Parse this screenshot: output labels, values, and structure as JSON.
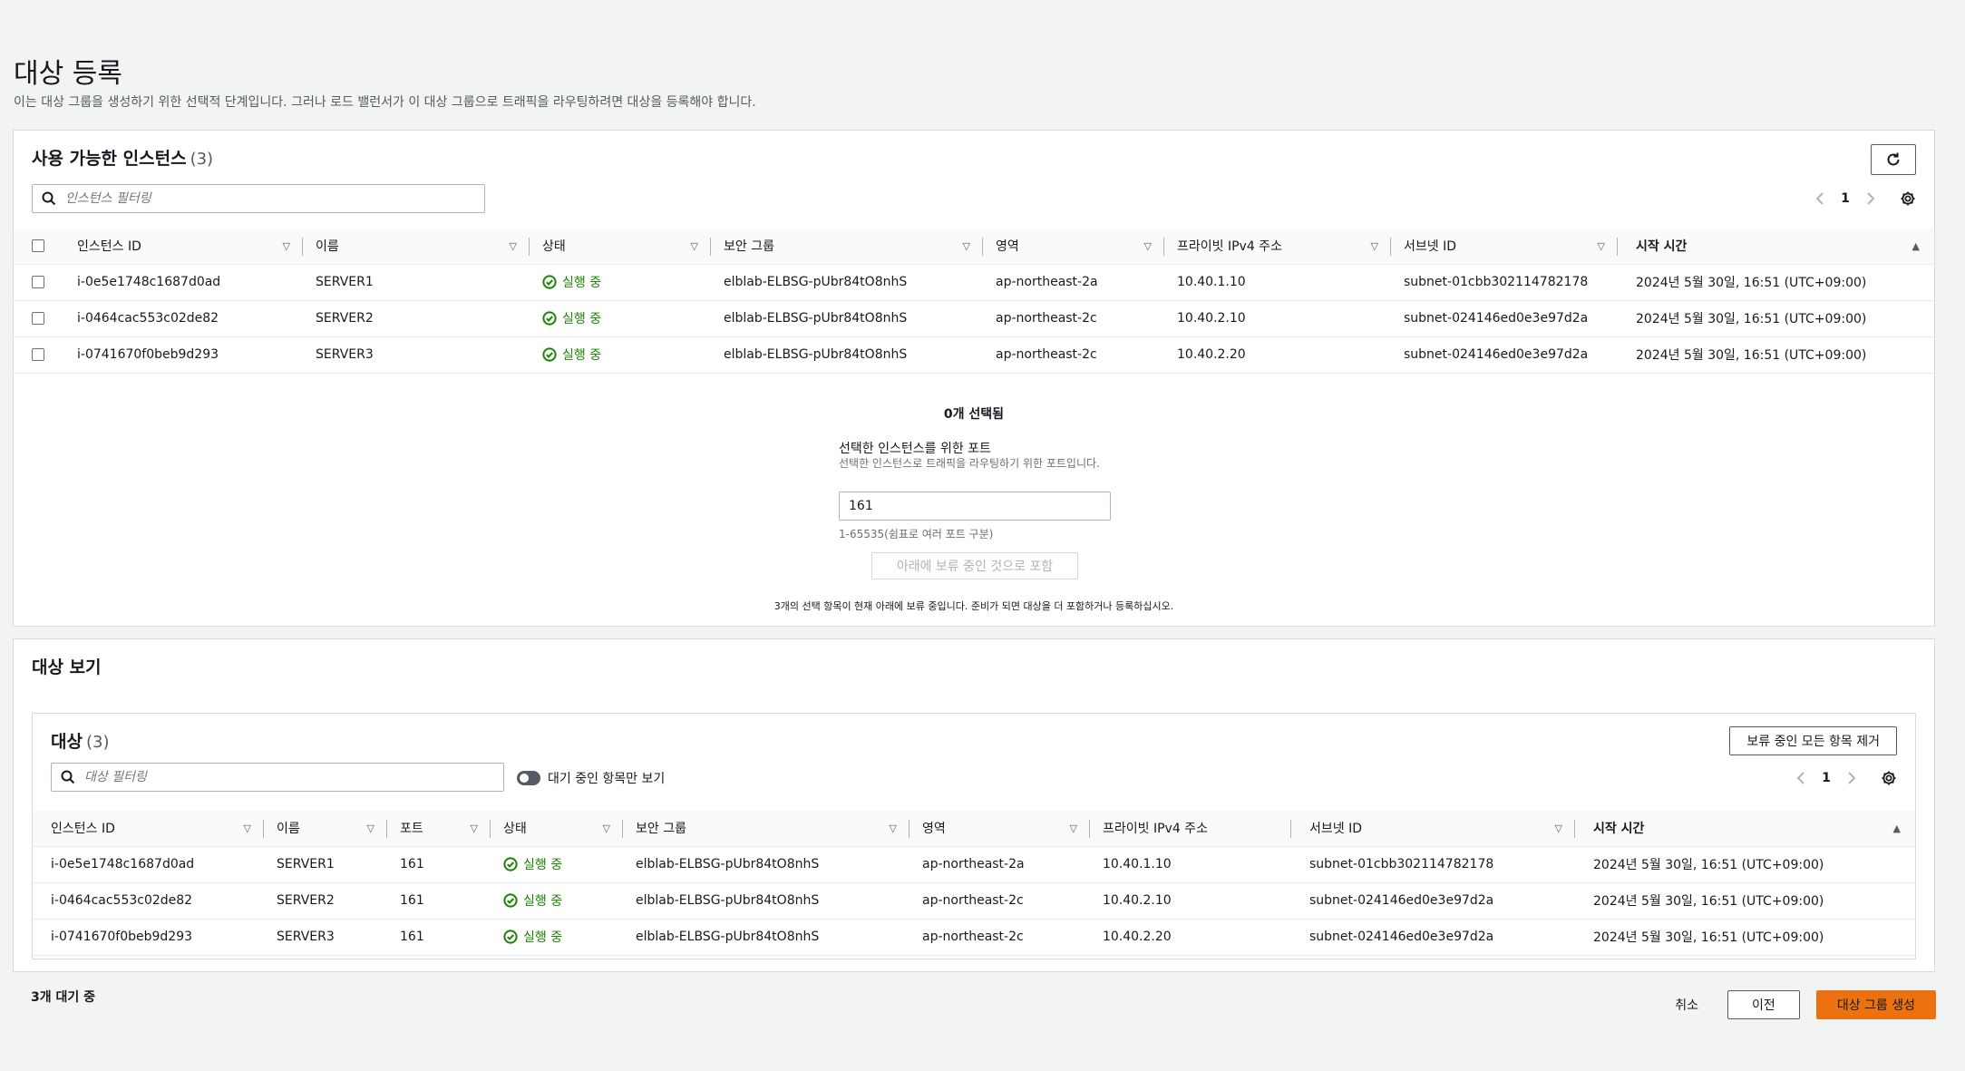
{
  "page": {
    "title": "대상 등록",
    "description": "이는 대상 그룹을 생성하기 위한 선택적 단계입니다. 그러나 로드 밸런서가 이 대상 그룹으로 트래픽을 라우팅하려면 대상을 등록해야 합니다."
  },
  "available": {
    "title": "사용 가능한 인스턴스",
    "count": "(3)",
    "filter_placeholder": "인스턴스 필터링",
    "page": "1",
    "columns": [
      "인스턴스 ID",
      "이름",
      "상태",
      "보안 그룹",
      "영역",
      "프라이빗 IPv4 주소",
      "서브넷 ID",
      "시작 시간"
    ],
    "rows": [
      {
        "id": "i-0e5e1748c1687d0ad",
        "name": "SERVER1",
        "state": "실행 중",
        "sg": "elblab-ELBSG-pUbr84tO8nhS",
        "zone": "ap-northeast-2a",
        "ip": "10.40.1.10",
        "subnet": "subnet-01cbb302114782178",
        "launch": "2024년 5월 30일, 16:51 (UTC+09:00)"
      },
      {
        "id": "i-0464cac553c02de82",
        "name": "SERVER2",
        "state": "실행 중",
        "sg": "elblab-ELBSG-pUbr84tO8nhS",
        "zone": "ap-northeast-2c",
        "ip": "10.40.2.10",
        "subnet": "subnet-024146ed0e3e97d2a",
        "launch": "2024년 5월 30일, 16:51 (UTC+09:00)"
      },
      {
        "id": "i-0741670f0beb9d293",
        "name": "SERVER3",
        "state": "실행 중",
        "sg": "elblab-ELBSG-pUbr84tO8nhS",
        "zone": "ap-northeast-2c",
        "ip": "10.40.2.20",
        "subnet": "subnet-024146ed0e3e97d2a",
        "launch": "2024년 5월 30일, 16:51 (UTC+09:00)"
      }
    ],
    "selected_count": "0개 선택됨",
    "port_label": "선택한 인스턴스를 위한 포트",
    "port_desc": "선택한 인스턴스로 트래픽을 라우팅하기 위한 포트입니다.",
    "port_value": "161",
    "port_hint": "1-65535(쉼표로 여러 포트 구분)",
    "include_button": "아래에 보류 중인 것으로 포함",
    "pending_note": "3개의 선택 항목이 현재 아래에 보류 중입니다. 준비가 되면 대상을 더 포함하거나 등록하십시오."
  },
  "review": {
    "title": "대상 보기",
    "targets_title": "대상",
    "targets_count": "(3)",
    "remove_all_button": "보류 중인 모든 항목 제거",
    "filter_placeholder": "대상 필터링",
    "toggle_label": "대기 중인 항목만 보기",
    "page": "1",
    "columns": [
      "인스턴스 ID",
      "이름",
      "포트",
      "상태",
      "보안 그룹",
      "영역",
      "프라이빗 IPv4 주소",
      "서브넷 ID",
      "시작 시간"
    ],
    "rows": [
      {
        "id": "i-0e5e1748c1687d0ad",
        "name": "SERVER1",
        "port": "161",
        "state": "실행 중",
        "sg": "elblab-ELBSG-pUbr84tO8nhS",
        "zone": "ap-northeast-2a",
        "ip": "10.40.1.10",
        "subnet": "subnet-01cbb302114782178",
        "launch": "2024년 5월 30일, 16:51 (UTC+09:00)"
      },
      {
        "id": "i-0464cac553c02de82",
        "name": "SERVER2",
        "port": "161",
        "state": "실행 중",
        "sg": "elblab-ELBSG-pUbr84tO8nhS",
        "zone": "ap-northeast-2c",
        "ip": "10.40.2.10",
        "subnet": "subnet-024146ed0e3e97d2a",
        "launch": "2024년 5월 30일, 16:51 (UTC+09:00)"
      },
      {
        "id": "i-0741670f0beb9d293",
        "name": "SERVER3",
        "port": "161",
        "state": "실행 중",
        "sg": "elblab-ELBSG-pUbr84tO8nhS",
        "zone": "ap-northeast-2c",
        "ip": "10.40.2.20",
        "subnet": "subnet-024146ed0e3e97d2a",
        "launch": "2024년 5월 30일, 16:51 (UTC+09:00)"
      }
    ]
  },
  "footer": {
    "pending_count": "3개 대기 중",
    "cancel": "취소",
    "previous": "이전",
    "create": "대상 그룹 생성"
  },
  "colors": {
    "primary": "#ec7211",
    "success": "#1d8102",
    "border": "#d5dbdb"
  },
  "icons": {
    "refresh": "refresh-icon",
    "search": "search-icon",
    "settings": "gear-icon",
    "status_running": "check-circle-icon"
  }
}
